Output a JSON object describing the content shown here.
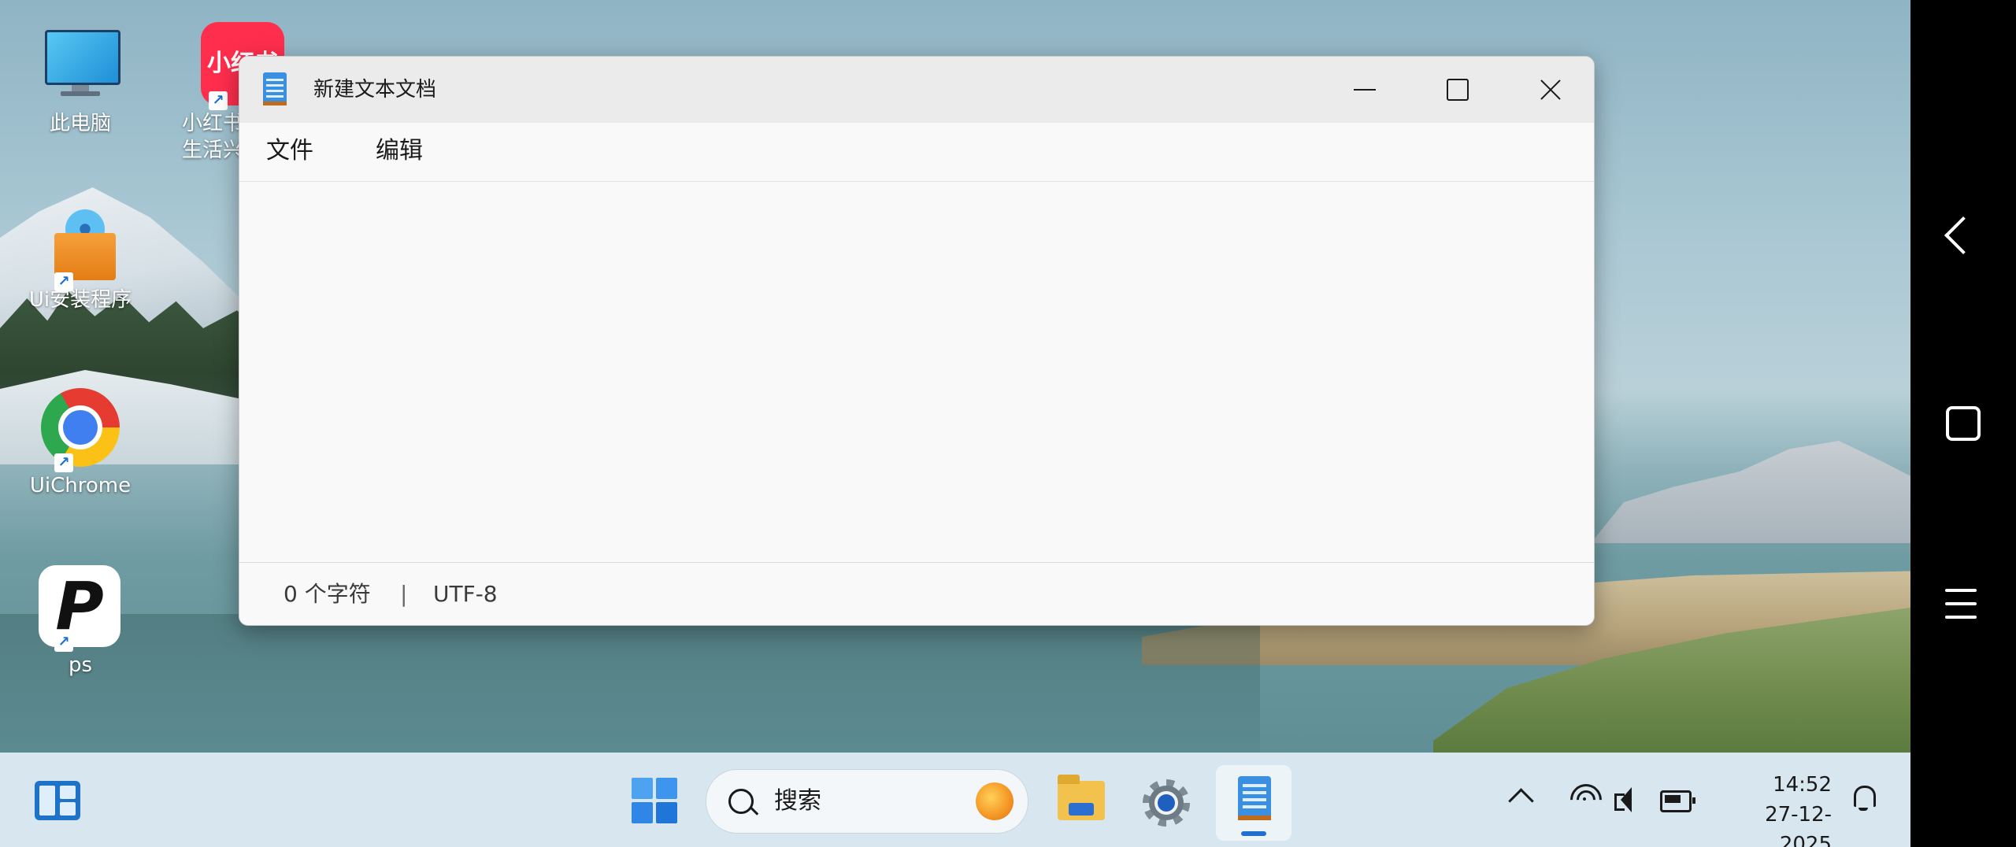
{
  "desktop": {
    "icons": [
      {
        "label": "此电脑",
        "icon": "this-pc-icon"
      },
      {
        "label": "小红书\n生活兴",
        "line1": "小红书",
        "line2": "生活兴",
        "tile_text": "小红书",
        "icon": "xiaohongshu-icon"
      },
      {
        "label": "Ui安装程序",
        "icon": "installer-icon"
      },
      {
        "label": "UiChrome",
        "icon": "chrome-icon"
      },
      {
        "label": "ps",
        "icon": "ps-icon",
        "tile_text": "P"
      }
    ]
  },
  "window": {
    "title": "新建文本文档",
    "app_icon": "notepad-icon",
    "controls": {
      "minimize": "minimize-icon",
      "maximize": "maximize-icon",
      "close": "close-icon"
    },
    "menu": {
      "file": "文件",
      "edit": "编辑"
    },
    "content": "",
    "status": {
      "chars": "0 个字符",
      "separator": "|",
      "encoding": "UTF-8"
    }
  },
  "taskbar": {
    "search_placeholder": "搜索",
    "apps": [
      "widgets-icon",
      "start-icon",
      "file-explorer-icon",
      "settings-icon",
      "notepad-icon"
    ],
    "tray": {
      "time": "14:52",
      "date": "27-12-2025"
    }
  },
  "navbar": {
    "buttons": [
      "back-icon",
      "home-icon",
      "menu-icon"
    ]
  },
  "colors": {
    "taskbar": "#d7e6ef",
    "window_bg": "#f9f9f9",
    "accent": "#1f6fd1"
  }
}
